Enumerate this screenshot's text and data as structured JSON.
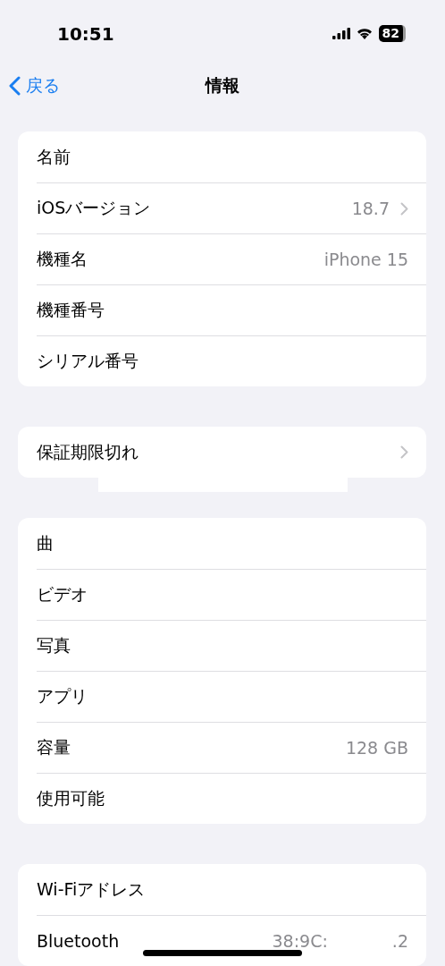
{
  "status_bar": {
    "time": "10:51",
    "battery": "82"
  },
  "nav": {
    "back": "戻る",
    "title": "情報"
  },
  "groups": [
    {
      "rows": [
        {
          "label": "名前",
          "kind": "plain"
        },
        {
          "label": "iOSバージョン",
          "value": "18.7",
          "kind": "link"
        },
        {
          "label": "機種名",
          "value": "iPhone 15",
          "kind": "plain"
        },
        {
          "label": "機種番号",
          "kind": "plain"
        },
        {
          "label": "シリアル番号",
          "kind": "plain"
        }
      ]
    },
    {
      "rows": [
        {
          "label": "保証期限切れ",
          "kind": "link"
        }
      ]
    },
    {
      "rows": [
        {
          "label": "曲",
          "kind": "plain"
        },
        {
          "label": "ビデオ",
          "kind": "plain"
        },
        {
          "label": "写真",
          "kind": "plain"
        },
        {
          "label": "アプリ",
          "kind": "plain"
        },
        {
          "label": "容量",
          "value": "128 GB",
          "kind": "plain"
        },
        {
          "label": "使用可能",
          "kind": "plain"
        }
      ]
    },
    {
      "rows": [
        {
          "label": "Wi-Fiアドレス",
          "kind": "plain"
        },
        {
          "label": "Bluetooth",
          "value": "38:9C:",
          "value_tail": ".2",
          "kind": "plain"
        }
      ]
    }
  ]
}
